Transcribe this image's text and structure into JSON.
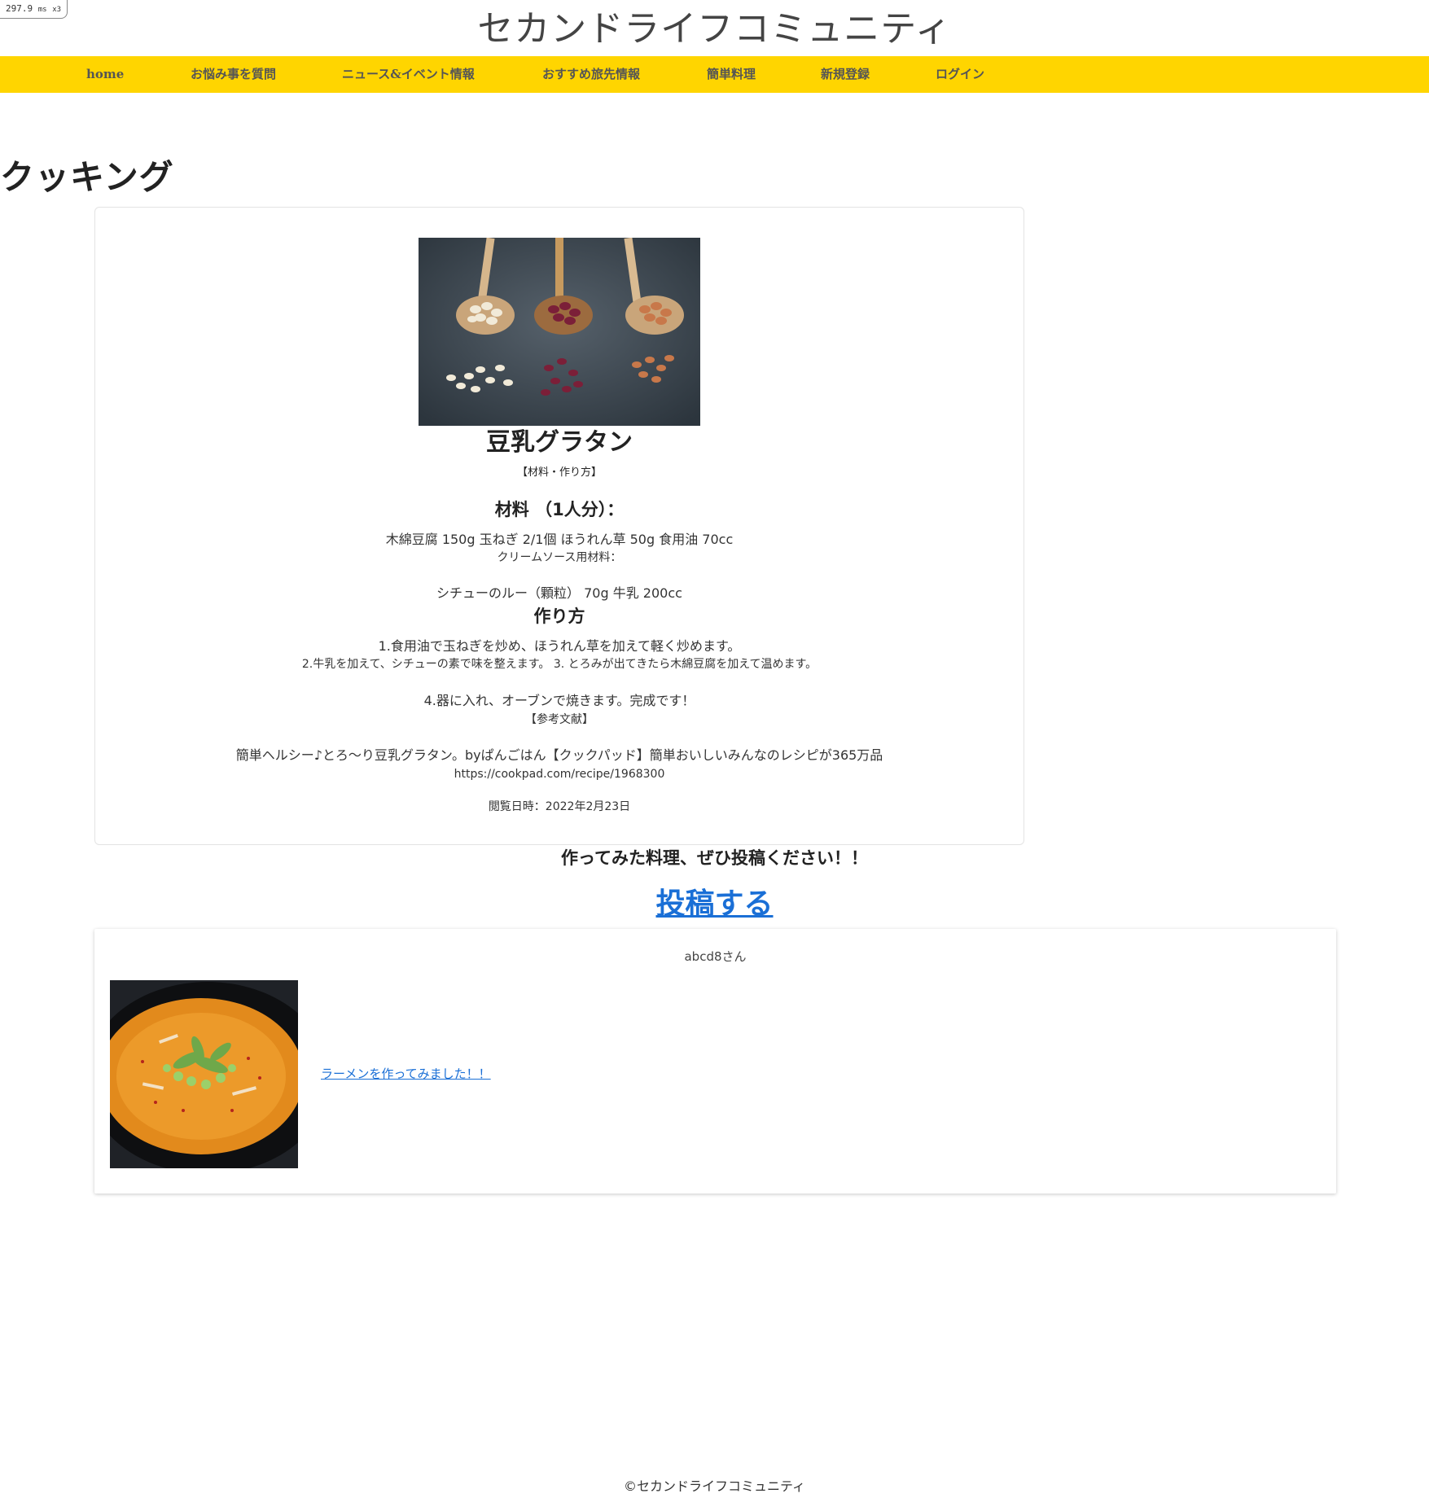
{
  "perf_badge": {
    "value": "297.9",
    "unit": "ms",
    "multiplier": "x3"
  },
  "site": {
    "title": "セカンドライフコミュニティ"
  },
  "nav": {
    "items": [
      {
        "label": "home"
      },
      {
        "label": "お悩み事を質問"
      },
      {
        "label": "ニュース&イベント情報"
      },
      {
        "label": "おすすめ旅先情報"
      },
      {
        "label": "簡単料理"
      },
      {
        "label": "新規登録"
      },
      {
        "label": "ログイン"
      }
    ]
  },
  "page": {
    "heading": "クッキング"
  },
  "recipe": {
    "image": "beans-on-spoons-photo",
    "title": "豆乳グラタン",
    "section_label": "【材料・作り方】",
    "ingredients_heading": "材料 （1人分）：",
    "ingredients_line": "木綿豆腐 150g 玉ねぎ 2/1個 ほうれん草 50g 食用油 70cc",
    "cream_sauce_label": "クリームソース用材料：",
    "cream_sauce_line": "シチューのルー（顆粒） 70g 牛乳 200cc",
    "steps_heading": "作り方",
    "step_1": "1.食用油で玉ねぎを炒め、ほうれん草を加えて軽く炒めます。",
    "step_2_3": "2.牛乳を加えて、シチューの素で味を整えます。 3. とろみが出てきたら木綿豆腐を加えて温めます。",
    "step_4": "4.器に入れ、オーブンで焼きます。完成です！",
    "reference_label": "【参考文献】",
    "reference_title": "簡単ヘルシー♪とろ～り豆乳グラタン。byぱんごはん【クックパッド】簡単おいしいみんなのレシピが365万品",
    "reference_url": "https://cookpad.com/recipe/1968300",
    "accessed": "閲覧日時：2022年2月23日"
  },
  "cta": {
    "text": "作ってみた料理、ぜひ投稿ください！！",
    "post_link": "投稿する"
  },
  "posts": [
    {
      "author": "abcd8さん",
      "image": "ramen-bowl-photo",
      "caption": "ラーメンを作ってみました！！"
    }
  ],
  "footer": {
    "copyright": "©セカンドライフコミュニティ"
  },
  "colors": {
    "nav_bg": "#ffd500",
    "link": "#1a6fd6"
  }
}
